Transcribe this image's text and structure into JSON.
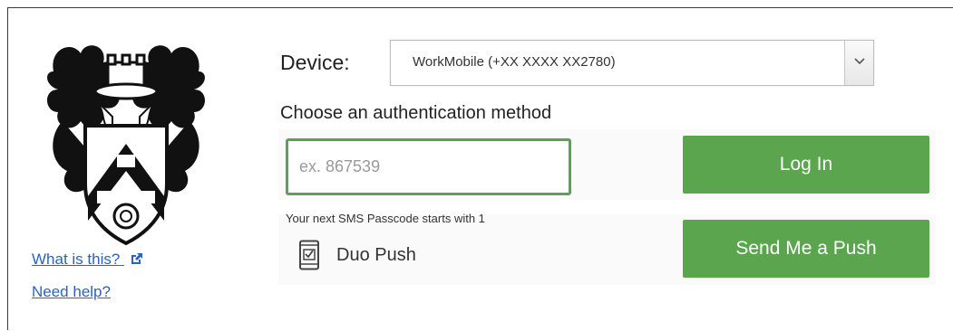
{
  "left": {
    "what_is_this": "What is this?",
    "need_help": "Need help?"
  },
  "device": {
    "label": "Device:",
    "selected": "WorkMobile (+XX XXXX XX2780)"
  },
  "method_heading": "Choose an authentication method",
  "passcode": {
    "placeholder": "ex. 867539",
    "button": "Log In",
    "hint": "Your next SMS Passcode starts with 1"
  },
  "push": {
    "label": "Duo Push",
    "button": "Send Me a Push"
  },
  "colors": {
    "accent_green": "#5aa54e",
    "link_blue": "#2b63c1"
  }
}
